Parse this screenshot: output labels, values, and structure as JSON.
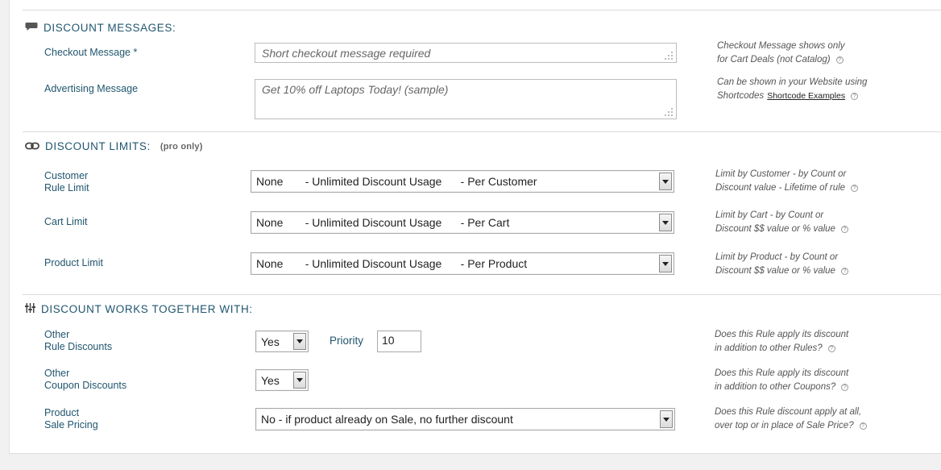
{
  "sections": {
    "messages": {
      "title": "DISCOUNT MESSAGES:"
    },
    "limits": {
      "title": "DISCOUNT LIMITS:",
      "badge": "(pro only)"
    },
    "together": {
      "title": "DISCOUNT WORKS TOGETHER WITH:"
    }
  },
  "checkout_message": {
    "label": "Checkout Message *",
    "placeholder": "Short checkout message required",
    "help_line1": "Checkout Message shows only",
    "help_line2": "for Cart Deals (not Catalog)"
  },
  "advertising_message": {
    "label": "Advertising Message",
    "placeholder": "Get 10% off Laptops Today! (sample)",
    "help_line1": "Can be shown in your Website using",
    "help_line2": "Shortcodes",
    "help_link": "Shortcode Examples"
  },
  "customer_rule_limit": {
    "label_line1": "Customer",
    "label_line2": "Rule Limit",
    "selected": "None       - Unlimited Discount Usage      - Per Customer",
    "help_line1": "Limit by Customer - by Count or",
    "help_line2": "Discount value - Lifetime of rule"
  },
  "cart_limit": {
    "label": "Cart Limit",
    "selected": "None       - Unlimited Discount Usage      - Per Cart",
    "help_line1": "Limit by Cart - by Count or",
    "help_line2": "Discount $$ value or % value"
  },
  "product_limit": {
    "label": "Product Limit",
    "selected": "None       - Unlimited Discount Usage      - Per Product",
    "help_line1": "Limit by Product - by Count or",
    "help_line2": "Discount $$ value or % value"
  },
  "other_rule_discounts": {
    "label_line1": "Other",
    "label_line2": "Rule Discounts",
    "selected": "Yes",
    "priority_label": "Priority",
    "priority_value": "10",
    "help_line1": "Does this Rule apply its discount",
    "help_line2": "in addition to other Rules?"
  },
  "other_coupon_discounts": {
    "label_line1": "Other",
    "label_line2": "Coupon Discounts",
    "selected": "Yes",
    "help_line1": "Does this Rule apply its discount",
    "help_line2": "in addition to other Coupons?"
  },
  "product_sale_pricing": {
    "label_line1": "Product",
    "label_line2": "Sale Pricing",
    "selected": "No - if product already on Sale, no further discount",
    "help_line1": "Does this Rule discount apply at all,",
    "help_line2": "over top or in place of Sale Price?"
  },
  "help_icon_glyph": "?",
  "icons": [
    "speech-bubble-icon",
    "chain-link-icon",
    "sliders-icon",
    "help-icon",
    "dropdown-arrow-icon",
    "resize-grip-icon"
  ]
}
